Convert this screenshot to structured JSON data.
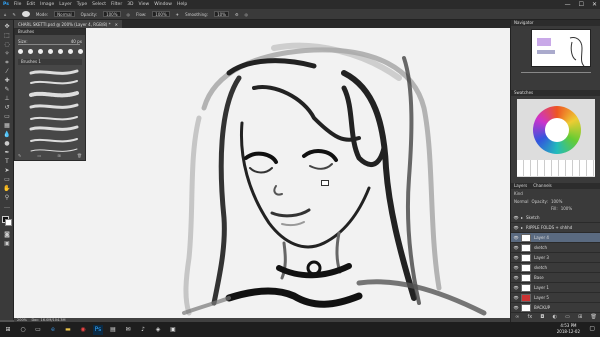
{
  "menubar": {
    "app_icon": "Ps",
    "items": [
      "File",
      "Edit",
      "Image",
      "Layer",
      "Type",
      "Select",
      "Filter",
      "3D",
      "View",
      "Window",
      "Help"
    ],
    "window_controls": [
      "—",
      "☐",
      "✕"
    ]
  },
  "options": {
    "mode_label": "Mode:",
    "mode_value": "Normal",
    "opacity_label": "Opacity:",
    "opacity_value": "100%",
    "flow_label": "Flow:",
    "flow_value": "100%",
    "smoothing_label": "Smoothing:",
    "smoothing_value": "10%"
  },
  "document": {
    "tab_title": "CHARL SKETTI.psd @ 200% (Layer 4, RGB/8) *",
    "zoom": "200%",
    "doc_size": "Doc: 16.0M/104.3M"
  },
  "brushes_panel": {
    "title": "Brushes",
    "size_label": "Size:",
    "size_value": "40 px",
    "group_label": "Brushes 1"
  },
  "navigator": {
    "tabs": [
      "Navigator"
    ]
  },
  "swatches_panel": {
    "tabs": [
      "Swatches"
    ]
  },
  "layers_panel": {
    "tabs": [
      "Layers",
      "Channels"
    ],
    "kind_label": "Kind",
    "blend_mode": "Normal",
    "opacity_label": "Opacity:",
    "opacity_value": "100%",
    "fill_label": "Fill:",
    "fill_value": "100%",
    "layers": [
      {
        "name": "Sketch",
        "selected": false
      },
      {
        "name": "RIPPLE FOLDS + shhhd",
        "selected": false
      },
      {
        "name": "Layer 4",
        "selected": true
      },
      {
        "name": "sketch",
        "selected": false
      },
      {
        "name": "Layer 3",
        "selected": false
      },
      {
        "name": "sketch",
        "selected": false
      },
      {
        "name": "Base",
        "selected": false
      },
      {
        "name": "Layer 1",
        "selected": false
      },
      {
        "name": "Layer 5",
        "selected": false
      },
      {
        "name": "BACKUP",
        "selected": false
      }
    ]
  },
  "taskbar": {
    "time": "4:53 PM",
    "date": "2018-12-02"
  },
  "colors": {
    "accent": "#5a6a80",
    "ui_dark": "#3a3a3a"
  }
}
